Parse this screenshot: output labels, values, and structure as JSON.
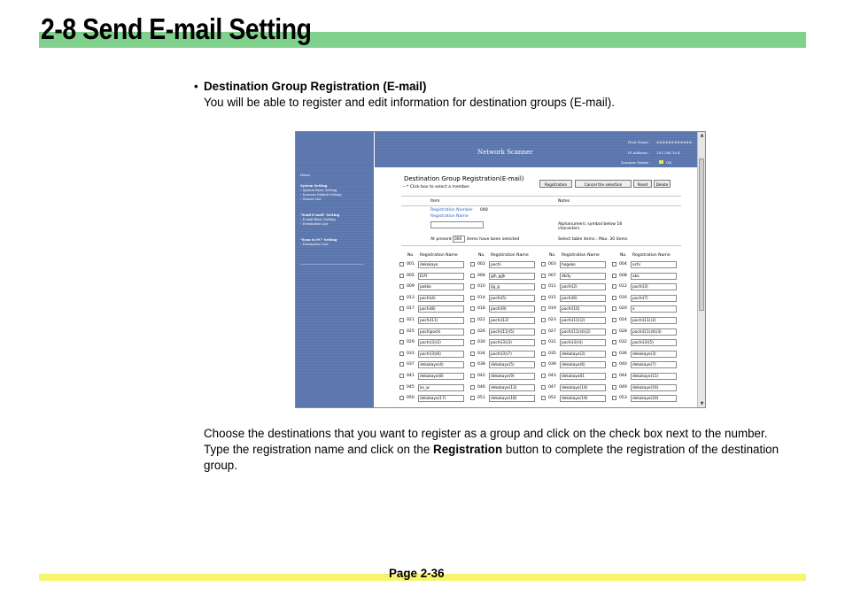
{
  "header": {
    "title": "2-8  Send E-mail Setting"
  },
  "intro": {
    "bullet": "•",
    "heading": "Destination Group Registration (E-mail)",
    "description": "You will be able to register and edit information for destination groups (E-mail)."
  },
  "screenshot": {
    "sidebar": [
      "Home",
      "System Setting",
      "› System Basic Setting",
      "› Scanner Default Setting",
      "› Scaner List",
      "\"Send E-mail\" Setting",
      "› E-mail Basic Setting",
      "› Destination List",
      "\"Scan to PC\" Setting",
      "› Destination List"
    ],
    "banner_title": "Network Scanner",
    "host_name_label": "Host Name :",
    "host_name_value": "############",
    "ip_label": "IP Address :",
    "ip_value": "192.168.10.4",
    "status_label": "Scanner Status :",
    "status_value": "OK",
    "page_title": "Destination Group Registration(E-mail)",
    "page_subtitle": "---* Click box to select a member.",
    "buttons": {
      "registration": "Registration",
      "cancel_selection": "Cancel the selection",
      "reset": "Reset",
      "delete": "Delete"
    },
    "item_label": "Item",
    "notes_label": "Notes",
    "reg_number_label": "Registration Number",
    "reg_number_value": "048",
    "reg_name_label": "Registration Name",
    "note1": "Alphanumeric symbol below 16 characters",
    "at_present": "At present",
    "selected_count": "000",
    "selected_suffix": "items have been selected",
    "note2": "Select table items : Max. 30 items",
    "col_no": "No.",
    "col_name": "Registration Name",
    "entries": [
      [
        "001",
        "dekokayo"
      ],
      [
        "002",
        "pochi"
      ],
      [
        "003",
        "hogeko"
      ],
      [
        "004",
        "ochi"
      ],
      [
        "005",
        "EUY"
      ],
      [
        "006",
        "gjh_gjjk"
      ],
      [
        "007",
        "dkdy"
      ],
      [
        "008",
        "ako"
      ],
      [
        "009",
        "pokko"
      ],
      [
        "010",
        "ijg_g"
      ],
      [
        "011",
        "pochi(2)"
      ],
      [
        "012",
        "pochi(3)"
      ],
      [
        "013",
        "pochi(4)"
      ],
      [
        "014",
        "pochi(5)"
      ],
      [
        "015",
        "pochi(6)"
      ],
      [
        "016",
        "pochi(7)"
      ],
      [
        "017",
        "pochi(8)"
      ],
      [
        "018",
        "pochi(9)"
      ],
      [
        "019",
        "pochi(10)"
      ],
      [
        "020",
        "x"
      ],
      [
        "021",
        "pochi(11)"
      ],
      [
        "022",
        "pochi(12)"
      ],
      [
        "023",
        "pochi(11)(2)"
      ],
      [
        "024",
        "pochi(11)(3)"
      ],
      [
        "025",
        "pochipochi"
      ],
      [
        "026",
        "pochi(11)(5)"
      ],
      [
        "027",
        "pochi(11)(4)(2)"
      ],
      [
        "028",
        "pochi(11)(4)(3)"
      ],
      [
        "029",
        "pochi(3)(2)"
      ],
      [
        "030",
        "pochi(3)(3)"
      ],
      [
        "031",
        "pochi(3)(4)"
      ],
      [
        "032",
        "pochi(3)(5)"
      ],
      [
        "033",
        "pochi(3)(6)"
      ],
      [
        "034",
        "pochi(3)(7)"
      ],
      [
        "035",
        "dekokayo(2)"
      ],
      [
        "036",
        "dekokayo(3)"
      ],
      [
        "037",
        "dekokayo(4)"
      ],
      [
        "038",
        "dekokayo(5)"
      ],
      [
        "039",
        "dekokayo(6)"
      ],
      [
        "040",
        "dekokayo(7)"
      ],
      [
        "041",
        "dekokayo(8)"
      ],
      [
        "042",
        "dekokayo(9)"
      ],
      [
        "043",
        "dekokayo01"
      ],
      [
        "044",
        "dekokayo(11)"
      ],
      [
        "045",
        "kv_w"
      ],
      [
        "046",
        "dekokayo(13)"
      ],
      [
        "047",
        "dekokayo(14)"
      ],
      [
        "049",
        "dekokayo(16)"
      ],
      [
        "050",
        "dekokayo(17)"
      ],
      [
        "051",
        "dekokayo(18)"
      ],
      [
        "052",
        "dekokayo(19)"
      ],
      [
        "053",
        "dekokayo(20)"
      ]
    ]
  },
  "paragraph": {
    "before": "Choose the destinations that you want to register as a group and click on the check box next to the number. Type the registration name and click on the ",
    "bold": "Registration",
    "after": " button to complete the registration of the destination group."
  },
  "footer": {
    "page": "Page 2-36"
  }
}
